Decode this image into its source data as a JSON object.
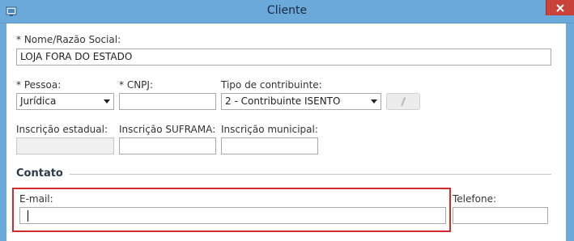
{
  "window": {
    "title": "Cliente",
    "icon": "app-icon",
    "close_icon": "close-icon"
  },
  "form": {
    "nome": {
      "label": "* Nome/Razão Social:",
      "value": "LOJA FORA DO ESTADO"
    },
    "pessoa": {
      "label": "* Pessoa:",
      "selected": "Jurídica"
    },
    "cnpj": {
      "label": "* CNPJ:",
      "value": ""
    },
    "tipo_contribuinte": {
      "label": "Tipo de contribuinte:",
      "selected": "2 - Contribuinte ISENTO"
    },
    "tipo_action_icon": "edit-icon",
    "inscricao_estadual": {
      "label": "Inscrição estadual:",
      "value": ""
    },
    "inscricao_suframa": {
      "label": "Inscrição SUFRAMA:",
      "value": ""
    },
    "inscricao_municipal": {
      "label": "Inscrição municipal:",
      "value": ""
    }
  },
  "contato": {
    "title": "Contato",
    "email": {
      "label": "E-mail:",
      "value": ""
    },
    "telefone": {
      "label": "Telefone:",
      "value": ""
    }
  },
  "colors": {
    "titlebar": "#6aa9d9",
    "close": "#c8423a",
    "highlight": "#d32b2b"
  }
}
